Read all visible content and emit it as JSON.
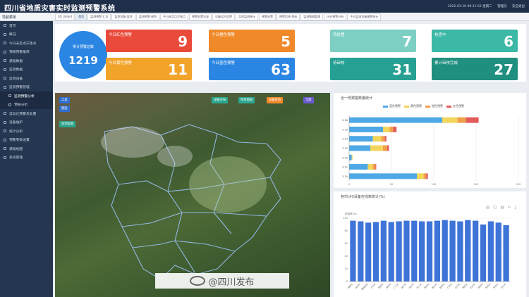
{
  "header": {
    "title": "四川省地质灾害实时监测预警系统",
    "datetime": "2021-03-16 09:11:52 星期二",
    "user": "管理员",
    "logout": "安全退出"
  },
  "nav_title": "导航菜单",
  "tabs": [
    "3D Unbird",
    "首页",
    "监测预警·汇总",
    "监测设备·监控",
    "监测预警·规则",
    "今日未定点灾害点",
    "预警处置记录",
    "设备实时告警",
    "实时监测统计",
    "预警处置",
    "预警信息·审核",
    "监测数据管理",
    "历史预警分析",
    "今日监测设备报警统计"
  ],
  "sidebar": {
    "items": [
      {
        "label": "首页"
      },
      {
        "label": "概况"
      },
      {
        "label": "今日未定点灾害点"
      },
      {
        "label": "预报预警推荐"
      },
      {
        "label": "基础数据"
      },
      {
        "label": "监测数据"
      },
      {
        "label": "监测设备"
      },
      {
        "label": "监测预警管理"
      },
      {
        "label": "监测预警分析"
      },
      {
        "label": "预报分析"
      },
      {
        "label": "自动化预警及处置"
      },
      {
        "label": "设备维护"
      },
      {
        "label": "统计分析"
      },
      {
        "label": "预警零数设置"
      },
      {
        "label": "基础地图"
      },
      {
        "label": "系统管理"
      }
    ],
    "active_index": 8
  },
  "stats": {
    "total_label": "累计预警总数",
    "total_value": "1219",
    "cards": [
      {
        "label": "今日红色预警",
        "value": "9",
        "color": "#e94a3a"
      },
      {
        "label": "今日橙色预警",
        "value": "5",
        "color": "#f0892a"
      },
      {
        "label": "待处置",
        "value": "7",
        "color": "#7dcfc3"
      },
      {
        "label": "核查中",
        "value": "6",
        "color": "#3bb8a6"
      },
      {
        "label": "今日黄色预警",
        "value": "11",
        "color": "#f2a42a"
      },
      {
        "label": "今日蓝色预警",
        "value": "63",
        "color": "#2a86e2"
      },
      {
        "label": "待审核",
        "value": "31",
        "color": "#26a092"
      },
      {
        "label": "累计审核完成",
        "value": "27",
        "color": "#1f8f7f"
      }
    ]
  },
  "map": {
    "buttons": {
      "tools": "工具",
      "layer": "图层",
      "device_layer": "设备分布",
      "project": "项目图层",
      "legend_btn": "设备状态",
      "fullscreen": "全屏",
      "equipment": "监测设备"
    }
  },
  "bar_panel": {
    "title": "近一周预警数量统计",
    "legend": [
      "蓝色预警",
      "黄色预警",
      "橙色预警",
      "红色预警"
    ],
    "colors": [
      "#4ea8e6",
      "#f3d55a",
      "#f0a04b",
      "#e45b5b"
    ],
    "tools": "▣ ◫ ↻ ⤓"
  },
  "column_panel": {
    "title": "各市(州)设备在线率统计(%)",
    "ylabel": "在线率(%)",
    "tools": "▤ ◫ ▥ ↻ ⤓",
    "color": "#3e74d8"
  },
  "watermark": "@四川发布",
  "chart_data": [
    {
      "type": "bar",
      "orientation": "horizontal",
      "stacked": true,
      "title": "近一周预警数量统计",
      "categories": [
        "3-10",
        "3-11",
        "3-12",
        "3-13",
        "3-14",
        "3-15",
        "3-16"
      ],
      "series": [
        {
          "name": "蓝色预警",
          "values": [
            80,
            22,
            3,
            25,
            28,
            40,
            110
          ]
        },
        {
          "name": "黄色预警",
          "values": [
            8,
            6,
            1,
            15,
            10,
            8,
            18
          ]
        },
        {
          "name": "橙色预警",
          "values": [
            3,
            3,
            0,
            5,
            4,
            4,
            10
          ]
        },
        {
          "name": "红色预警",
          "values": [
            2,
            1,
            0,
            2,
            2,
            4,
            15
          ]
        }
      ],
      "xlim": [
        0,
        200
      ],
      "xticks": [
        "0",
        "50",
        "100",
        "150",
        "200"
      ]
    },
    {
      "type": "bar",
      "title": "各市(州)设备在线率统计(%)",
      "ylabel": "在线率(%)",
      "ylim": [
        0,
        100
      ],
      "yticks": [
        "0",
        "20",
        "40",
        "60",
        "80",
        "100"
      ],
      "categories": [
        "成都市",
        "自贡市",
        "攀枝花市",
        "泸州市",
        "德阳市",
        "绵阳市",
        "广元市",
        "遂宁市",
        "内江市",
        "乐山市",
        "南充市",
        "眉山市",
        "宜宾市",
        "广安市",
        "达州市",
        "雅安市",
        "巴中市",
        "资阳市",
        "阿坝州",
        "甘孜州",
        "凉山州"
      ],
      "values": [
        96,
        95,
        93,
        94,
        96,
        94,
        95,
        96,
        96,
        95,
        95,
        96,
        97,
        96,
        95,
        97,
        96,
        90,
        95,
        93,
        89
      ]
    }
  ]
}
